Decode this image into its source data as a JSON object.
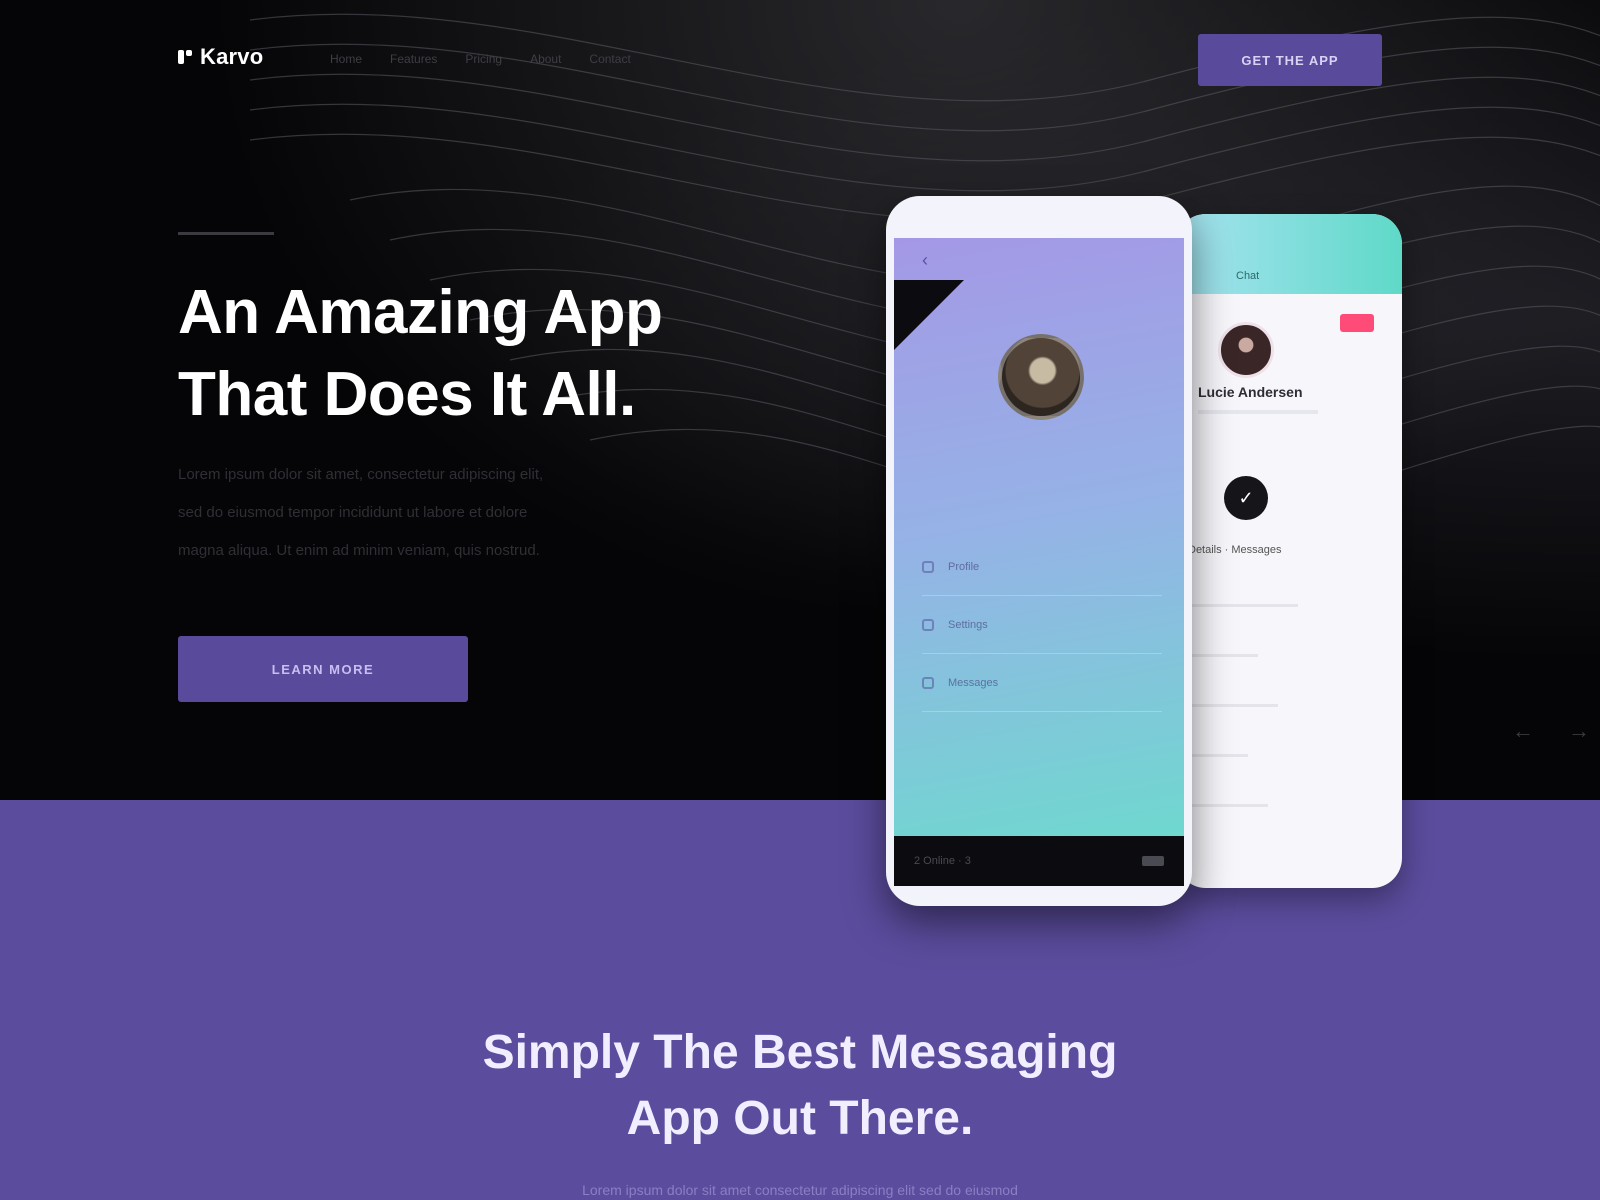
{
  "brand": {
    "name": "Karvo",
    "icon": "logo-icon"
  },
  "nav": {
    "items": [
      "Home",
      "Features",
      "Pricing",
      "About",
      "Contact"
    ]
  },
  "header_button": {
    "label": "Get the App"
  },
  "hero": {
    "title_line1": "An Amazing App",
    "title_line2": "That Does It All.",
    "description": [
      "Lorem ipsum dolor sit amet, consectetur adipiscing elit,",
      "sed do eiusmod tempor incididunt ut labore et dolore",
      "magna aliqua. Ut enim ad minim veniam, quis nostrud."
    ],
    "cta_label": "Learn More",
    "arrows": [
      "←",
      "→"
    ]
  },
  "phone_front": {
    "back_icon": "chevron-left-icon",
    "menu": [
      "Profile",
      "Settings",
      "Messages"
    ],
    "bottom_text": "2 Online · 3"
  },
  "phone_back": {
    "header_label": "Chat",
    "name": "Lucie Andersen",
    "info": "Details · Messages"
  },
  "section": {
    "title_line1": "Simply The Best Messaging",
    "title_line2": "App Out There.",
    "subtitle": "Lorem ipsum dolor sit amet consectetur adipiscing elit sed do eiusmod"
  },
  "colors": {
    "accent": "#5a4a9c",
    "section_bg": "#5b4c9d",
    "hero_bg": "#050507",
    "teal": "#5fd9c8"
  }
}
